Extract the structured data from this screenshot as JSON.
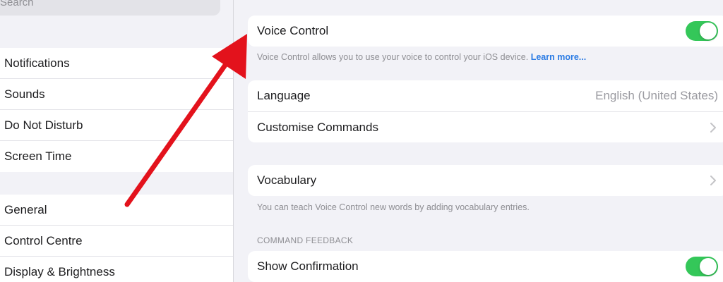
{
  "sidebar": {
    "search_placeholder": "Search",
    "group1": [
      {
        "label": "Notifications"
      },
      {
        "label": "Sounds"
      },
      {
        "label": "Do Not Disturb"
      },
      {
        "label": "Screen Time"
      }
    ],
    "group2": [
      {
        "label": "General"
      },
      {
        "label": "Control Centre"
      },
      {
        "label": "Display & Brightness"
      }
    ]
  },
  "main": {
    "voice_control": {
      "label": "Voice Control",
      "enabled": true,
      "description": "Voice Control allows you to use your voice to control your iOS device.",
      "learn_more": "Learn more..."
    },
    "language": {
      "label": "Language",
      "value": "English (United States)"
    },
    "customise_commands": {
      "label": "Customise Commands"
    },
    "vocabulary": {
      "label": "Vocabulary",
      "description": "You can teach Voice Control new words by adding vocabulary entries."
    },
    "command_feedback": {
      "header": "COMMAND FEEDBACK",
      "show_confirmation": {
        "label": "Show Confirmation",
        "enabled": true
      }
    }
  },
  "icons": {
    "search": "magnifier-icon",
    "chevron": "chevron-right-icon",
    "arrow": "red-annotation-arrow"
  },
  "colors": {
    "accent_green": "#34c759",
    "link_blue": "#2a7be4",
    "arrow_red": "#e3121c",
    "background": "#f2f2f7"
  }
}
